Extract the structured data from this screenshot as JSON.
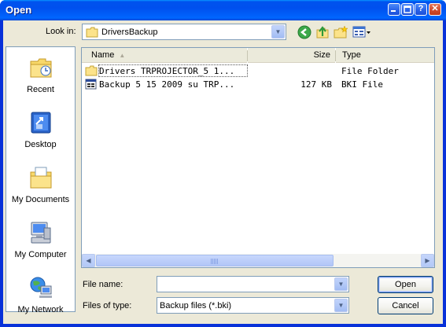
{
  "window": {
    "title": "Open",
    "controls": {
      "help": "?",
      "close": "✕"
    }
  },
  "lookin": {
    "label": "Look in:",
    "value": "DriversBackup"
  },
  "toolbar": {
    "icons": [
      "back-icon",
      "up-folder-icon",
      "new-folder-icon",
      "views-menu-icon"
    ]
  },
  "places": [
    {
      "label": "Recent",
      "icon": "recent-documents-icon"
    },
    {
      "label": "Desktop",
      "icon": "desktop-icon"
    },
    {
      "label": "My Documents",
      "icon": "my-documents-icon"
    },
    {
      "label": "My Computer",
      "icon": "my-computer-icon"
    },
    {
      "label": "My Network",
      "icon": "my-network-icon"
    }
  ],
  "filelist": {
    "columns": {
      "name": "Name",
      "size": "Size",
      "type": "Type"
    },
    "rows": [
      {
        "name": "Drivers TRPROJECTOR_5 1...",
        "size": "",
        "type": "File Folder",
        "icon": "folder-icon"
      },
      {
        "name": "Backup 5 15 2009 su TRP...",
        "size": "127 KB",
        "type": "BKI File",
        "icon": "bki-file-icon"
      }
    ]
  },
  "footer": {
    "filename_label": "File name:",
    "filename_value": "",
    "filetype_label": "Files of type:",
    "filetype_value": "Backup files (*.bki)",
    "open_label": "Open",
    "cancel_label": "Cancel"
  },
  "colors": {
    "titlebar": "#0053ee",
    "dialog_bg": "#ece9d8",
    "border_blue": "#7f9db9"
  }
}
